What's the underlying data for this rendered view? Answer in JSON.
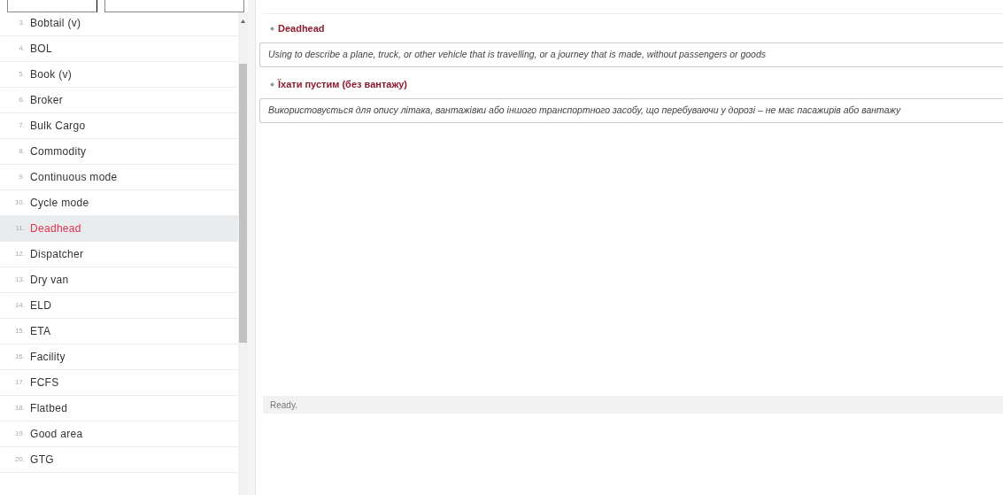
{
  "sidebar": {
    "filters": [
      {
        "kind": "field"
      },
      {
        "kind": "field"
      }
    ],
    "items": [
      {
        "number": "3.",
        "term": "Bobtail (v)",
        "selected": false
      },
      {
        "number": "4.",
        "term": "BOL",
        "selected": false
      },
      {
        "number": "5.",
        "term": "Book (v)",
        "selected": false
      },
      {
        "number": "6.",
        "term": "Broker",
        "selected": false
      },
      {
        "number": "7.",
        "term": "Bulk Cargo",
        "selected": false
      },
      {
        "number": "8.",
        "term": "Commodity",
        "selected": false
      },
      {
        "number": "9.",
        "term": "Continuous mode",
        "selected": false
      },
      {
        "number": "10.",
        "term": "Cycle mode",
        "selected": false
      },
      {
        "number": "11.",
        "term": "Deadhead",
        "selected": true
      },
      {
        "number": "12.",
        "term": "Dispatcher",
        "selected": false
      },
      {
        "number": "13.",
        "term": "Dry van",
        "selected": false
      },
      {
        "number": "14.",
        "term": "ELD",
        "selected": false
      },
      {
        "number": "15.",
        "term": "ETA",
        "selected": false
      },
      {
        "number": "16.",
        "term": "Facility",
        "selected": false
      },
      {
        "number": "17.",
        "term": "FCFS",
        "selected": false
      },
      {
        "number": "18.",
        "term": "Flatbed",
        "selected": false
      },
      {
        "number": "19.",
        "term": "Good area",
        "selected": false
      },
      {
        "number": "20.",
        "term": "GTG",
        "selected": false
      }
    ]
  },
  "entry": {
    "sections": [
      {
        "heading": "Deadhead",
        "definition": "Using to describe a plane, truck, or other vehicle that is travelling, or a journey that is made, without passengers or goods"
      },
      {
        "heading": "Їхати пустим (без вантажу)",
        "definition": "Використовується для опису літака, вантажівки або іншого транспортного засобу, що перебуваючи у дорозі – не має пасажирів або вантажу"
      }
    ]
  },
  "status_bar": "Ready."
}
